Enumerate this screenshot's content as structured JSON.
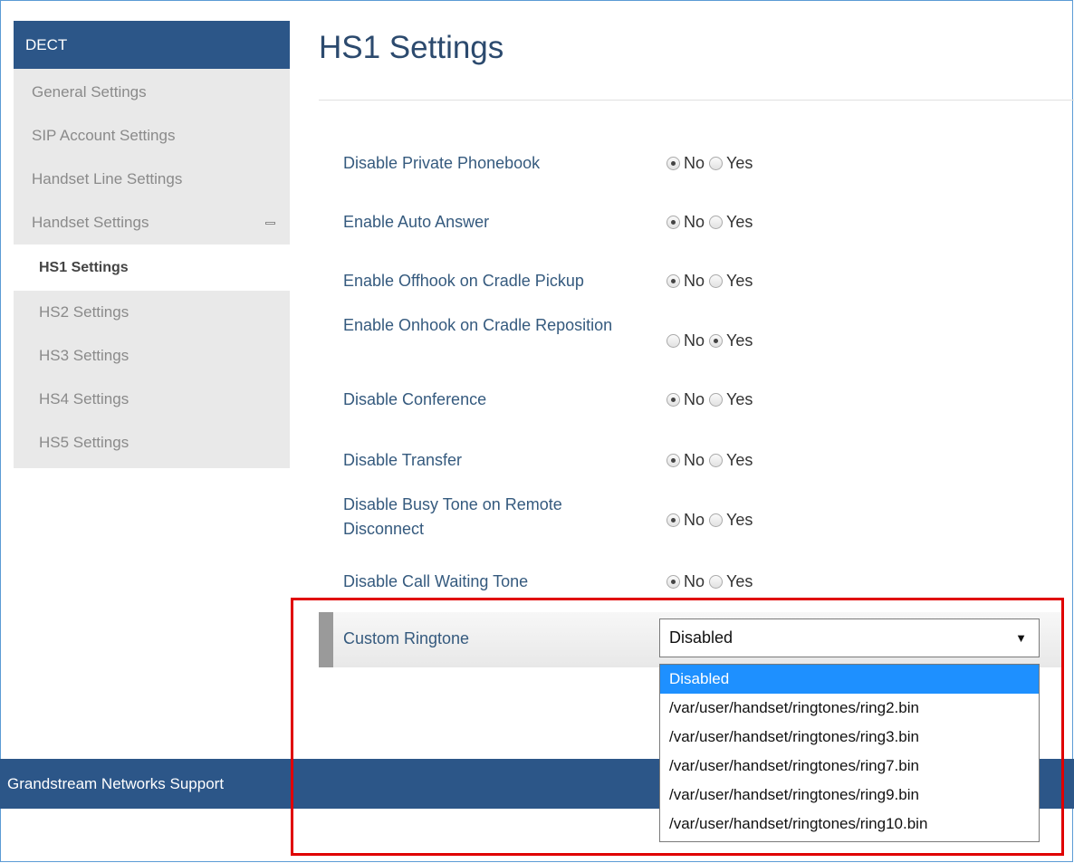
{
  "sidebar": {
    "header": "DECT",
    "items": [
      {
        "label": "General Settings"
      },
      {
        "label": "SIP Account Settings"
      },
      {
        "label": "Handset Line Settings"
      },
      {
        "label": "Handset Settings"
      }
    ],
    "active": "HS1 Settings",
    "sub_items": [
      {
        "label": "HS2 Settings"
      },
      {
        "label": "HS3 Settings"
      },
      {
        "label": "HS4 Settings"
      },
      {
        "label": "HS5 Settings"
      }
    ]
  },
  "page": {
    "title": "HS1 Settings"
  },
  "settings": [
    {
      "label": "Disable Private Phonebook",
      "no": "No",
      "yes": "Yes",
      "selected": "No"
    },
    {
      "label": "Enable Auto Answer",
      "no": "No",
      "yes": "Yes",
      "selected": "No"
    },
    {
      "label": "Enable Offhook on Cradle Pickup",
      "no": "No",
      "yes": "Yes",
      "selected": "No"
    },
    {
      "label": "Enable Onhook on Cradle Reposition",
      "no": "No",
      "yes": "Yes",
      "selected": "Yes"
    },
    {
      "label": "Disable Conference",
      "no": "No",
      "yes": "Yes",
      "selected": "No"
    },
    {
      "label": "Disable Transfer",
      "no": "No",
      "yes": "Yes",
      "selected": "No"
    },
    {
      "label": "Disable Busy Tone on Remote Disconnect",
      "no": "No",
      "yes": "Yes",
      "selected": "No"
    },
    {
      "label": "Disable Call Waiting Tone",
      "no": "No",
      "yes": "Yes",
      "selected": "No"
    }
  ],
  "ringtone": {
    "label": "Custom Ringtone",
    "value": "Disabled",
    "arrow": "▼",
    "options": [
      "Disabled",
      "/var/user/handset/ringtones/ring2.bin",
      "/var/user/handset/ringtones/ring3.bin",
      "/var/user/handset/ringtones/ring7.bin",
      "/var/user/handset/ringtones/ring9.bin",
      "/var/user/handset/ringtones/ring10.bin"
    ]
  },
  "footer": {
    "text": "Grandstream Networks Support"
  },
  "colors": {
    "nav_blue": "#2c5688",
    "highlight_red": "#e00000",
    "selection_blue": "#1e90ff"
  }
}
